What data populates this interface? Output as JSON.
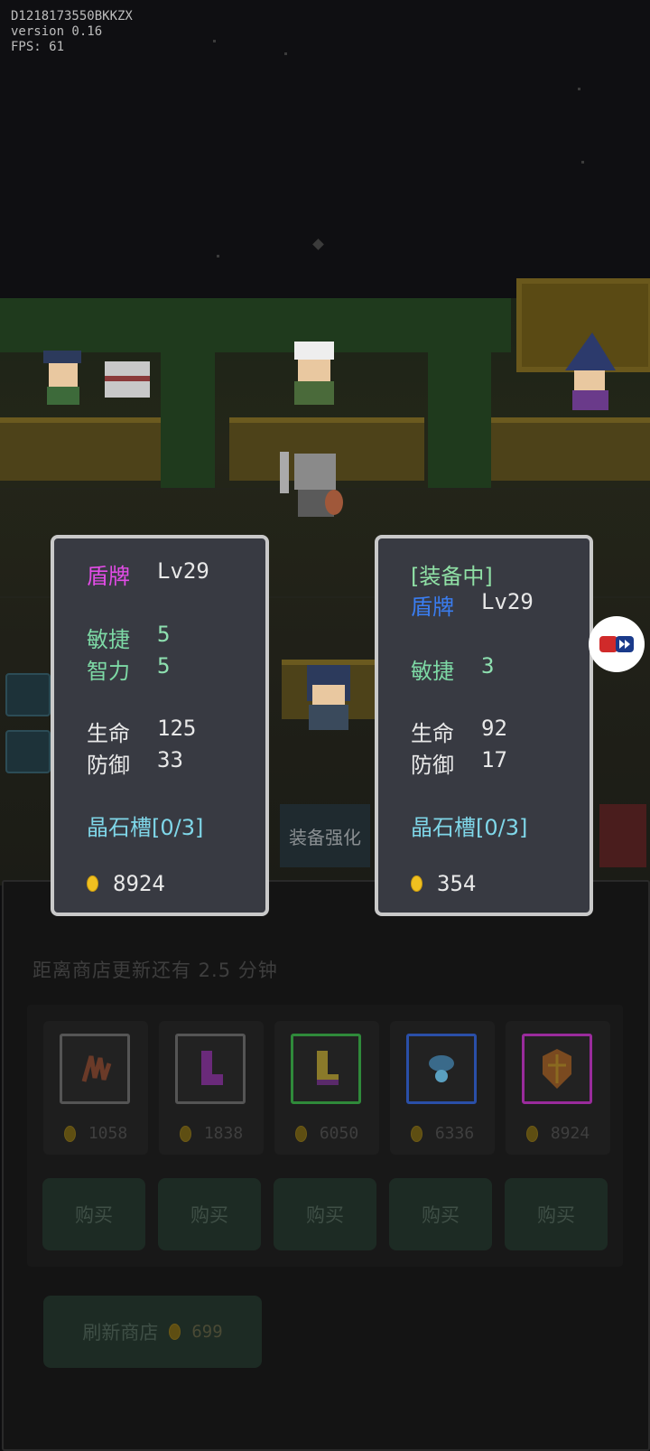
{
  "debug": {
    "device_id": "D1218173550BKKZX",
    "version": "version 0.16",
    "fps": "FPS: 61"
  },
  "scene": {
    "tab_label": "装备强化"
  },
  "popup_left": {
    "name": "盾牌",
    "level": "Lv29",
    "stat1_label": "敏捷",
    "stat1_value": "5",
    "stat2_label": "智力",
    "stat2_value": "5",
    "stat3_label": "生命",
    "stat3_value": "125",
    "stat4_label": "防御",
    "stat4_value": "33",
    "slots": "晶石槽[0/3]",
    "price": "8924"
  },
  "popup_right": {
    "equipped_tag": "[装备中]",
    "name": "盾牌",
    "level": "Lv29",
    "stat1_label": "敏捷",
    "stat1_value": "3",
    "stat3_label": "生命",
    "stat3_value": "92",
    "stat4_label": "防御",
    "stat4_value": "17",
    "slots": "晶石槽[0/3]",
    "price": "354"
  },
  "shop": {
    "timer_text": "距离商店更新还有 2.5 分钟",
    "items": [
      {
        "icon": "claw-icon",
        "price": "1058",
        "rarity_color": "#555555"
      },
      {
        "icon": "purple-boot-icon",
        "price": "1838",
        "rarity_color": "#555555"
      },
      {
        "icon": "yellow-boot-icon",
        "price": "6050",
        "rarity_color": "#2f8a3a"
      },
      {
        "icon": "blue-amulet-icon",
        "price": "6336",
        "rarity_color": "#2a4fa8"
      },
      {
        "icon": "shield-icon",
        "price": "8924",
        "rarity_color": "#9a2b9c"
      }
    ],
    "buy_label": "购买",
    "refresh_label": "刷新商店",
    "refresh_price": "699"
  }
}
